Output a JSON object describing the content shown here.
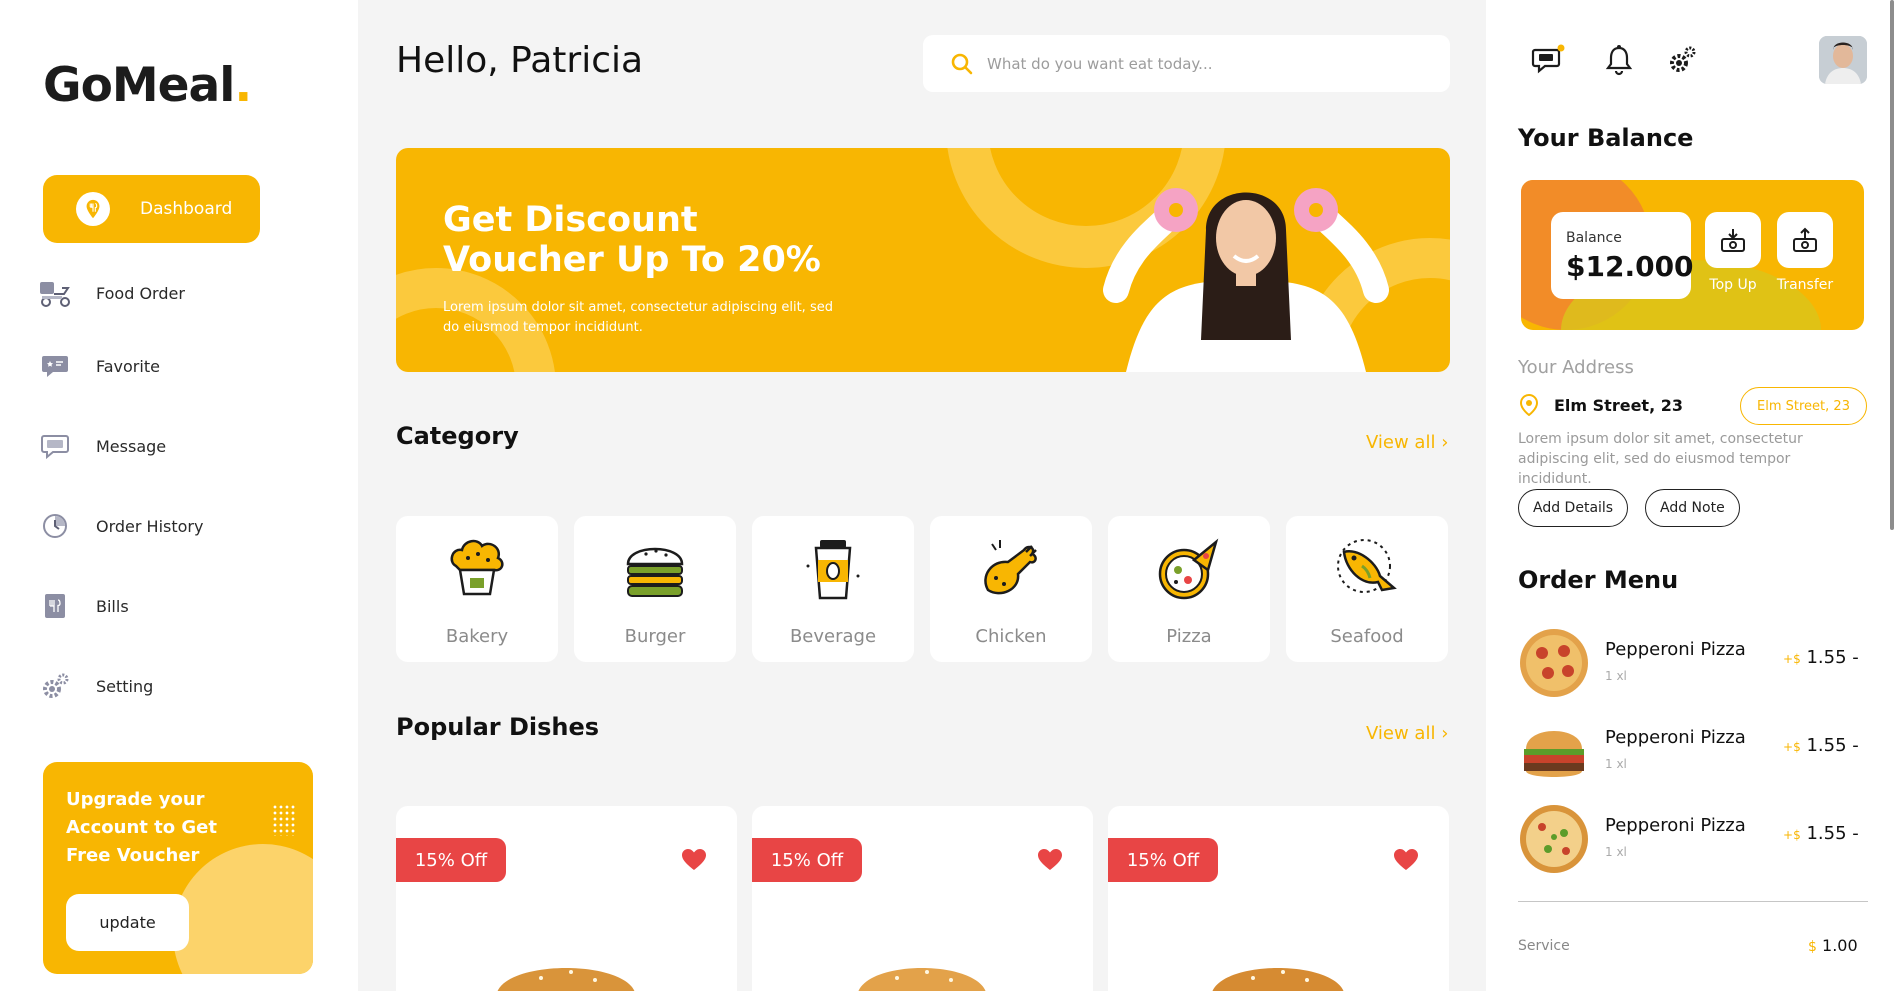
{
  "brand": {
    "name": "GoMeal",
    "dot": "."
  },
  "sidebar": {
    "items": [
      {
        "label": "Dashboard",
        "icon": "dashboard-icon"
      },
      {
        "label": "Food Order",
        "icon": "delivery-scooter-icon"
      },
      {
        "label": "Favorite",
        "icon": "favorite-icon"
      },
      {
        "label": "Message",
        "icon": "message-icon"
      },
      {
        "label": "Order History",
        "icon": "order-history-icon"
      },
      {
        "label": "Bills",
        "icon": "bills-icon"
      },
      {
        "label": "Setting",
        "icon": "gear-icon"
      }
    ],
    "upgrade": {
      "text": "Upgrade your Account to Get Free Voucher",
      "button": "update"
    }
  },
  "header": {
    "greeting": "Hello, Patricia",
    "search_placeholder": "What do you want eat today..."
  },
  "banner": {
    "title": "Get Discount Voucher Up To 20%",
    "subtitle": "Lorem ipsum dolor sit amet, consectetur adipiscing elit, sed do eiusmod tempor incididunt."
  },
  "category": {
    "title": "Category",
    "view_all": "View all",
    "items": [
      "Bakery",
      "Burger",
      "Beverage",
      "Chicken",
      "Pizza",
      "Seafood"
    ]
  },
  "popular": {
    "title": "Popular Dishes",
    "view_all": "View all",
    "dishes": [
      {
        "badge": "15% Off"
      },
      {
        "badge": "15% Off"
      },
      {
        "badge": "15% Off"
      }
    ]
  },
  "right": {
    "balance_title": "Your Balance",
    "balance_label": "Balance",
    "balance_value": "$12.000",
    "top_up": "Top Up",
    "transfer": "Transfer",
    "address_label": "Your Address",
    "address": "Elm Street, 23",
    "address_pill": "Elm Street, 23",
    "address_desc": "Lorem ipsum dolor sit amet, consectetur adipiscing elit, sed do eiusmod tempor incididunt.",
    "add_details": "Add Details",
    "add_note": "Add Note",
    "order_title": "Order Menu",
    "orders": [
      {
        "name": "Pepperoni Pizza",
        "qty": "1 xl",
        "plus": "+",
        "currency": "$",
        "price": "1.55 -"
      },
      {
        "name": "Pepperoni Pizza",
        "qty": "1 xl",
        "plus": "+",
        "currency": "$",
        "price": "1.55 -"
      },
      {
        "name": "Pepperoni Pizza",
        "qty": "1 xl",
        "plus": "+",
        "currency": "$",
        "price": "1.55 -"
      }
    ],
    "service_label": "Service",
    "service_currency": "$",
    "service_value": "1.00"
  },
  "colors": {
    "accent": "#f8b602",
    "badge": "#e84545",
    "orange": "#f28c28"
  }
}
